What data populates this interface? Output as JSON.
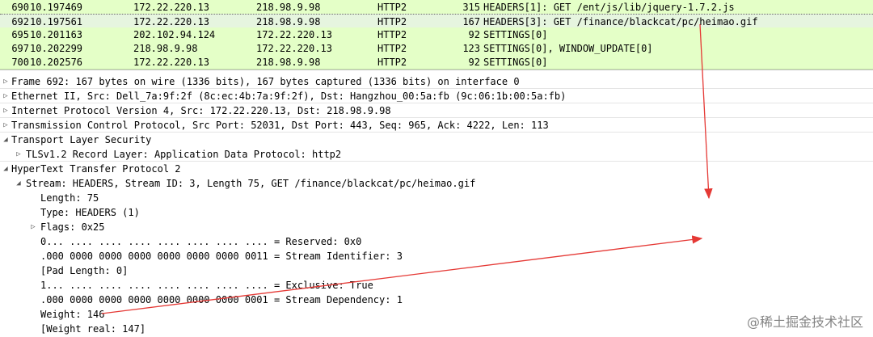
{
  "packet_list": {
    "rows": [
      {
        "no": "690",
        "time": "10.197469",
        "source": "172.22.220.13",
        "destination": "218.98.9.98",
        "protocol": "HTTP2",
        "length": "315",
        "info": "HEADERS[1]: GET /ent/js/lib/jquery-1.7.2.js",
        "selected": false
      },
      {
        "no": "692",
        "time": "10.197561",
        "source": "172.22.220.13",
        "destination": "218.98.9.98",
        "protocol": "HTTP2",
        "length": "167",
        "info": "HEADERS[3]: GET /finance/blackcat/pc/heimao.gif",
        "selected": true
      },
      {
        "no": "695",
        "time": "10.201163",
        "source": "202.102.94.124",
        "destination": "172.22.220.13",
        "protocol": "HTTP2",
        "length": "92",
        "info": "SETTINGS[0]",
        "selected": false
      },
      {
        "no": "697",
        "time": "10.202299",
        "source": "218.98.9.98",
        "destination": "172.22.220.13",
        "protocol": "HTTP2",
        "length": "123",
        "info": "SETTINGS[0], WINDOW_UPDATE[0]",
        "selected": false
      },
      {
        "no": "700",
        "time": "10.202576",
        "source": "172.22.220.13",
        "destination": "218.98.9.98",
        "protocol": "HTTP2",
        "length": "92",
        "info": "SETTINGS[0]",
        "selected": false
      }
    ]
  },
  "details": {
    "lines": [
      {
        "toggle": "▷",
        "text": "Frame 692: 167 bytes on wire (1336 bits), 167 bytes captured (1336 bits) on interface 0"
      },
      {
        "toggle": "▷",
        "text": "Ethernet II, Src: Dell_7a:9f:2f (8c:ec:4b:7a:9f:2f), Dst: Hangzhou_00:5a:fb (9c:06:1b:00:5a:fb)"
      },
      {
        "toggle": "▷",
        "text": "Internet Protocol Version 4, Src: 172.22.220.13, Dst: 218.98.9.98"
      },
      {
        "toggle": "▷",
        "text": "Transmission Control Protocol, Src Port: 52031, Dst Port: 443, Seq: 965, Ack: 4222, Len: 113"
      },
      {
        "toggle": "◢",
        "text": "Transport Layer Security"
      },
      {
        "toggle": "▷",
        "text": "TLSv1.2 Record Layer: Application Data Protocol: http2"
      },
      {
        "toggle": "◢",
        "text": "HyperText Transfer Protocol 2"
      },
      {
        "toggle": "◢",
        "text": "Stream: HEADERS, Stream ID: 3, Length 75, GET /finance/blackcat/pc/heimao.gif"
      },
      {
        "toggle": "",
        "text": "Length: 75"
      },
      {
        "toggle": "",
        "text": "Type: HEADERS (1)"
      },
      {
        "toggle": "▷",
        "text": "Flags: 0x25"
      },
      {
        "toggle": "",
        "text": "0... .... .... .... .... .... .... .... = Reserved: 0x0"
      },
      {
        "toggle": "",
        "text": ".000 0000 0000 0000 0000 0000 0000 0011 = Stream Identifier: 3"
      },
      {
        "toggle": "",
        "text": "[Pad Length: 0]"
      },
      {
        "toggle": "",
        "text": "1... .... .... .... .... .... .... .... = Exclusive: True"
      },
      {
        "toggle": "",
        "text": ".000 0000 0000 0000 0000 0000 0000 0001 = Stream Dependency: 1"
      },
      {
        "toggle": "",
        "text": "Weight: 146"
      },
      {
        "toggle": "",
        "text": "[Weight real: 147]"
      }
    ]
  },
  "watermark": {
    "text": "@稀土掘金技术社区"
  },
  "colors": {
    "packet_bg": "#e4ffc7",
    "selected_bg": "#e6f5df",
    "annotation_red": "#e53935"
  }
}
